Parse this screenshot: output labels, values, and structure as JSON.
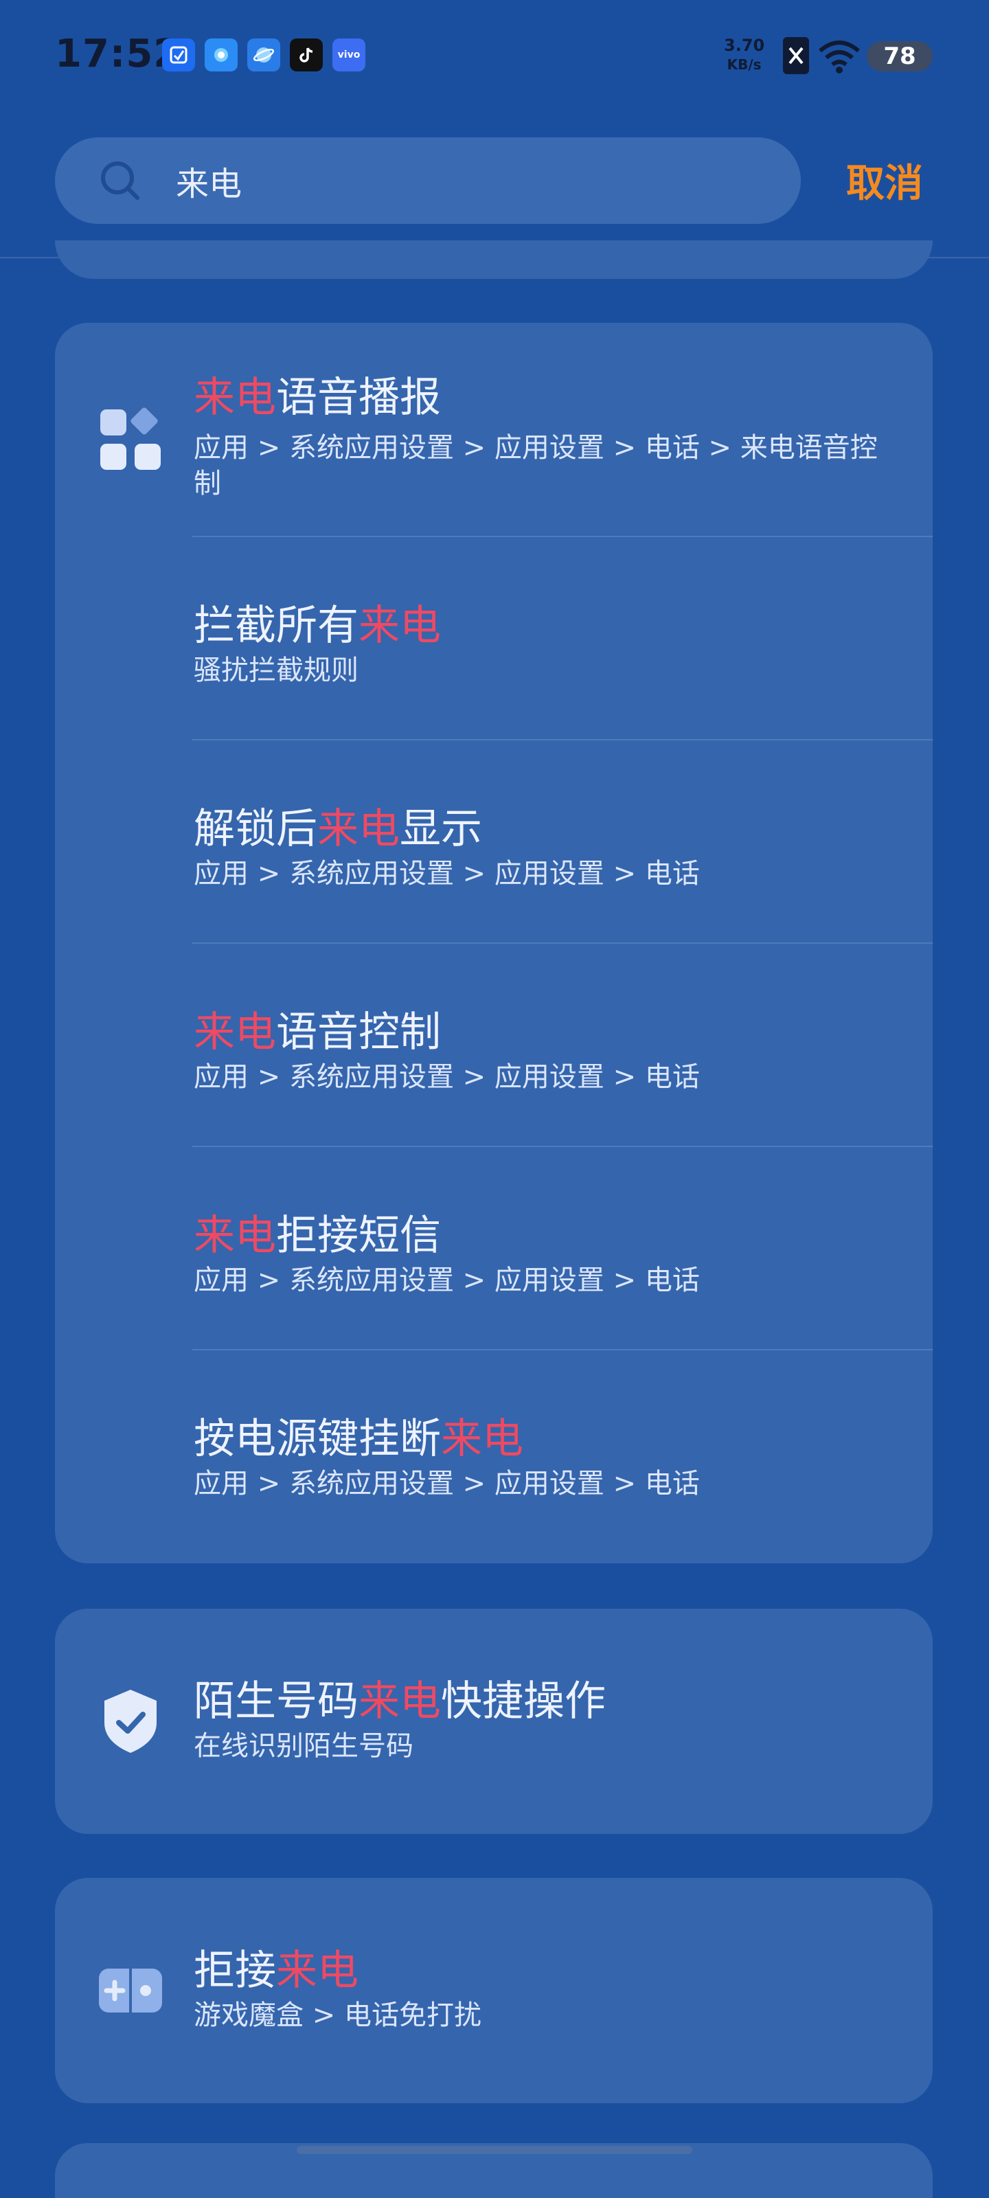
{
  "status_bar": {
    "time": "17:52",
    "net_speed_value": "3.70",
    "net_speed_unit": "KB/s",
    "battery": "78",
    "notifications": [
      {
        "name": "clean-app-icon",
        "color": "#1e6cf2"
      },
      {
        "name": "assistant-app-icon",
        "color": "#2b8cf5"
      },
      {
        "name": "browser-app-icon",
        "color": "#2a7de8"
      },
      {
        "name": "tiktok-app-icon",
        "color": "#111111"
      },
      {
        "name": "vivo-app-icon",
        "color": "#3d6df2",
        "text": "vivo"
      }
    ]
  },
  "search": {
    "query": "来电",
    "cancel_label": "取消"
  },
  "results": {
    "group1": [
      {
        "pre": "",
        "hl": "来电",
        "post": "语音播报",
        "path": "应用 > 系统应用设置 > 应用设置 > 电话 > 来电语音控制"
      },
      {
        "pre": "拦截所有",
        "hl": "来电",
        "post": "",
        "path": "骚扰拦截规则"
      },
      {
        "pre": "解锁后",
        "hl": "来电",
        "post": "显示",
        "path": "应用 > 系统应用设置 > 应用设置 > 电话"
      },
      {
        "pre": "",
        "hl": "来电",
        "post": "语音控制",
        "path": "应用 > 系统应用设置 > 应用设置 > 电话"
      },
      {
        "pre": "",
        "hl": "来电",
        "post": "拒接短信",
        "path": "应用 > 系统应用设置 > 应用设置 > 电话"
      },
      {
        "pre": "按电源键挂断",
        "hl": "来电",
        "post": "",
        "path": "应用 > 系统应用设置 > 应用设置 > 电话"
      }
    ],
    "group2": {
      "pre": "陌生号码",
      "hl": "来电",
      "post": "快捷操作",
      "path": "在线识别陌生号码"
    },
    "group3": {
      "pre": "拒接",
      "hl": "来电",
      "post": "",
      "path": "游戏魔盒 > 电话免打扰"
    }
  },
  "colors": {
    "background": "#1a4fa0",
    "card": "#3565ac",
    "highlight": "#ee4a63",
    "cancel": "#f58a1f"
  }
}
